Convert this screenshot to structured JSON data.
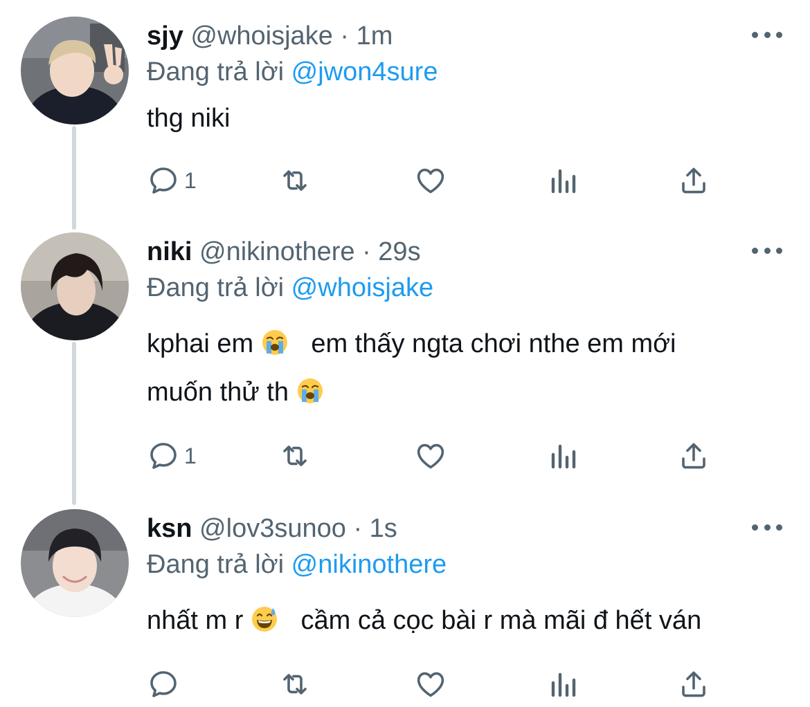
{
  "tweets": [
    {
      "name": "sjy",
      "handle": "@whoisjake",
      "sep": "·",
      "time": "1m",
      "reply_prefix": "Đang trả lời",
      "reply_to": "@jwon4sure",
      "text_lines": [
        "thg niki"
      ],
      "emojis": [],
      "reply_count": "1",
      "avatar_icon": "profile-photo-peace-sign"
    },
    {
      "name": "niki",
      "handle": "@nikinothere",
      "sep": "·",
      "time": "29s",
      "reply_prefix": "Đang trả lời",
      "reply_to": "@whoisjake",
      "text_parts": [
        "kphai em",
        "em thấy ngta chơi nthe em mới",
        "muốn thử th"
      ],
      "emojis": [
        "loudly-crying-face",
        "loudly-crying-face"
      ],
      "reply_count": "1",
      "avatar_icon": "profile-photo-dark-hair"
    },
    {
      "name": "ksn",
      "handle": "@lov3sunoo",
      "sep": "·",
      "time": "1s",
      "reply_prefix": "Đang trả lời",
      "reply_to": "@nikinothere",
      "text_parts": [
        "nhất m r",
        "cầm cả cọc bài r mà mãi đ hết ván"
      ],
      "emojis": [
        "grinning-face-with-sweat"
      ],
      "reply_count": "",
      "avatar_icon": "profile-photo-smiling"
    }
  ],
  "colors": {
    "text": "#0f1419",
    "secondary": "#536471",
    "link": "#1d9bf0",
    "thread_line": "#cfd9de"
  },
  "action_icons": [
    "reply-icon",
    "retweet-icon",
    "like-icon",
    "analytics-icon",
    "share-icon"
  ]
}
